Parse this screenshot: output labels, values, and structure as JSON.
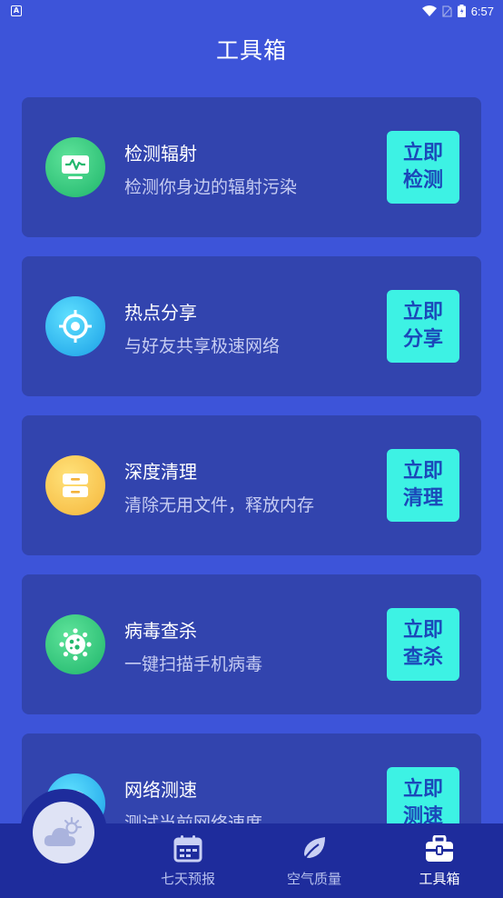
{
  "status_bar": {
    "time": "6:57",
    "app_badge": "A"
  },
  "page": {
    "title": "工具箱"
  },
  "tools": [
    {
      "title": "检测辐射",
      "desc": "检测你身边的辐射污染",
      "btn_line1": "立即",
      "btn_line2": "检测",
      "icon": "monitor-pulse-icon"
    },
    {
      "title": "热点分享",
      "desc": "与好友共享极速网络",
      "btn_line1": "立即",
      "btn_line2": "分享",
      "icon": "target-icon"
    },
    {
      "title": "深度清理",
      "desc": "清除无用文件，释放内存",
      "btn_line1": "立即",
      "btn_line2": "清理",
      "icon": "drawer-icon"
    },
    {
      "title": "病毒查杀",
      "desc": "一键扫描手机病毒",
      "btn_line1": "立即",
      "btn_line2": "查杀",
      "icon": "virus-icon"
    },
    {
      "title": "网络测速",
      "desc": "测试当前网络速度",
      "btn_line1": "立即",
      "btn_line2": "测速",
      "icon": "globe-icon"
    }
  ],
  "tab_bar": {
    "tabs": [
      {
        "label": "七天预报",
        "icon": "calendar-icon"
      },
      {
        "label": "空气质量",
        "icon": "leaf-icon"
      },
      {
        "label": "工具箱",
        "icon": "toolbox-icon",
        "active": true
      }
    ],
    "fab_icon": "weather-cloud-sun-icon"
  },
  "colors": {
    "background": "#3d54d9",
    "card": "#3244ae",
    "button": "#3df2e4",
    "button_text": "#1b48b9",
    "tab_bar": "#1e2c9c"
  }
}
